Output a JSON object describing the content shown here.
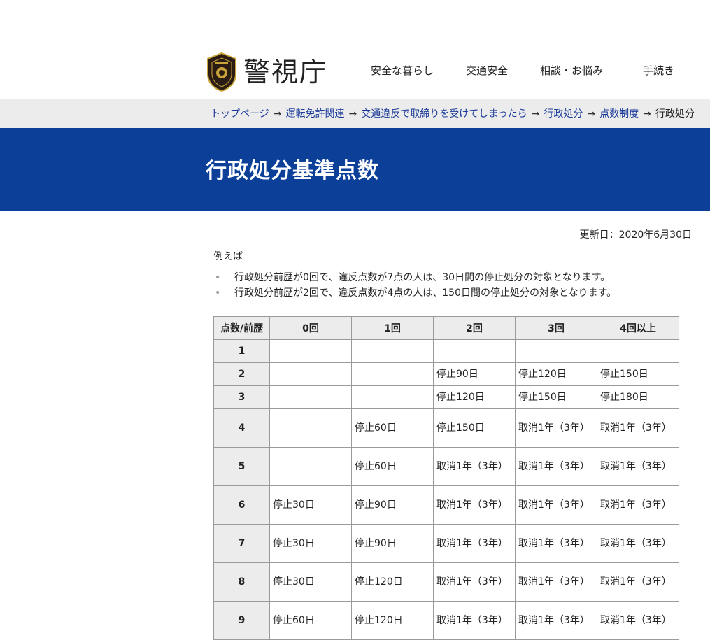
{
  "header": {
    "logo_text": "警視庁",
    "nav": [
      {
        "label": "安全な暮らし"
      },
      {
        "label": "交通安全"
      },
      {
        "label": "相談・お悩み"
      },
      {
        "label": "手続き"
      }
    ]
  },
  "breadcrumb": {
    "links": [
      "トップページ",
      "運転免許関連",
      "交通違反で取締りを受けてしまったら",
      "行政処分",
      "点数制度"
    ],
    "separator": "→",
    "current": "行政処分"
  },
  "page": {
    "title": "行政処分基準点数",
    "updated": "更新日：2020年6月30日",
    "lead": "例えば",
    "examples": [
      "行政処分前歴が0回で、違反点数が7点の人は、30日間の停止処分の対象となります。",
      "行政処分前歴が2回で、違反点数が4点の人は、150日間の停止処分の対象となります。"
    ]
  },
  "table": {
    "corner": "点数/前歴",
    "columns": [
      "0回",
      "1回",
      "2回",
      "3回",
      "4回以上"
    ],
    "rows": [
      {
        "points": "1",
        "cells": [
          "",
          "",
          "",
          "",
          ""
        ]
      },
      {
        "points": "2",
        "cells": [
          "",
          "",
          "停止90日",
          "停止120日",
          "停止150日"
        ]
      },
      {
        "points": "3",
        "cells": [
          "",
          "",
          "停止120日",
          "停止150日",
          "停止180日"
        ]
      },
      {
        "points": "4",
        "cells": [
          "",
          "停止60日",
          "停止150日",
          "取消1年（3年）",
          "取消1年（3年）"
        ]
      },
      {
        "points": "5",
        "cells": [
          "",
          "停止60日",
          "取消1年（3年）",
          "取消1年（3年）",
          "取消1年（3年）"
        ]
      },
      {
        "points": "6",
        "cells": [
          "停止30日",
          "停止90日",
          "取消1年（3年）",
          "取消1年（3年）",
          "取消1年（3年）"
        ]
      },
      {
        "points": "7",
        "cells": [
          "停止30日",
          "停止90日",
          "取消1年（3年）",
          "取消1年（3年）",
          "取消1年（3年）"
        ]
      },
      {
        "points": "8",
        "cells": [
          "停止30日",
          "停止120日",
          "取消1年（3年）",
          "取消1年（3年）",
          "取消1年（3年）"
        ]
      },
      {
        "points": "9",
        "cells": [
          "停止60日",
          "停止120日",
          "取消1年（3年）",
          "取消1年（3年）",
          "取消1年（3年）"
        ]
      }
    ]
  },
  "colors": {
    "title_band": "#0b3f98",
    "link": "#1a3b9a",
    "table_header_bg": "#ececec",
    "breadcrumb_bg": "#ececec",
    "emblem_gold": "#c9a23a"
  },
  "icons": {
    "logo": "police-emblem-icon",
    "bullet": "bullet-dot-icon"
  }
}
